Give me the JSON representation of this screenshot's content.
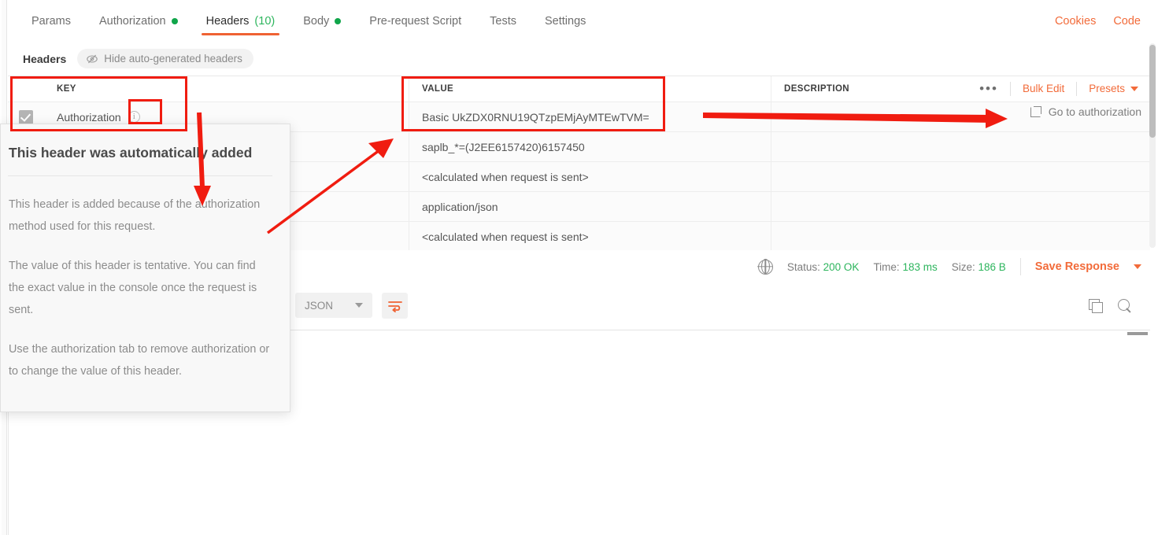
{
  "tabs": [
    {
      "label": "Params",
      "dot": false,
      "count": "",
      "active": false
    },
    {
      "label": "Authorization",
      "dot": true,
      "count": "",
      "active": false
    },
    {
      "label": "Headers",
      "dot": false,
      "count": "(10)",
      "active": true
    },
    {
      "label": "Body",
      "dot": true,
      "count": "",
      "active": false
    },
    {
      "label": "Pre-request Script",
      "dot": false,
      "count": "",
      "active": false
    },
    {
      "label": "Tests",
      "dot": false,
      "count": "",
      "active": false
    },
    {
      "label": "Settings",
      "dot": false,
      "count": "",
      "active": false
    }
  ],
  "tabbar_right": {
    "cookies": "Cookies",
    "code": "Code"
  },
  "subheader": {
    "title": "Headers",
    "hide_auto_label": "Hide auto-generated headers",
    "hide_auto_icon": "eye-slash-icon"
  },
  "table": {
    "columns": {
      "key": "KEY",
      "value": "VALUE",
      "description": "DESCRIPTION"
    },
    "tools": {
      "more_icon": "ellipsis-icon",
      "bulk_edit": "Bulk Edit",
      "presets": "Presets",
      "presets_caret": "chevron-down-icon"
    },
    "rows": [
      {
        "checked": true,
        "key": "Authorization",
        "info": true,
        "value": "Basic UkZDX0RNU19QTzpEMjAyMTEwTVM=",
        "description": ""
      },
      {
        "checked": true,
        "key": "",
        "info": false,
        "value": "saplb_*=(J2EE6157420)6157450",
        "description": ""
      },
      {
        "checked": true,
        "key": "",
        "info": false,
        "value": "<calculated when request is sent>",
        "description": ""
      },
      {
        "checked": true,
        "key": "",
        "info": false,
        "value": "application/json",
        "description": ""
      },
      {
        "checked": true,
        "key": "",
        "info": false,
        "value": "<calculated when request is sent>",
        "description": ""
      }
    ],
    "goto_auth": {
      "label": "Go to authorization",
      "icon": "external-link-icon"
    }
  },
  "popover": {
    "title": "This header was automatically added",
    "paragraphs": [
      "This header is added because of the authorization method used for this request.",
      "The value of this header is tentative. You can find the exact value in the console once the request is sent.",
      "Use the authorization tab to remove authorization or to change the value of this header."
    ]
  },
  "response": {
    "globe_icon": "globe-icon",
    "status_label": "Status:",
    "status_value": "200 OK",
    "time_label": "Time:",
    "time_value": "183 ms",
    "size_label": "Size:",
    "size_value": "186 B",
    "save_response": "Save Response",
    "save_caret": "chevron-down-icon",
    "format_select": "JSON",
    "format_caret": "chevron-down-icon",
    "wrap_icon": "word-wrap-icon",
    "copy_icon": "copy-icon",
    "search_icon": "search-icon"
  },
  "colors": {
    "accent": "#f26b3a",
    "tab_underline": "#ef6233",
    "success": "#2db55d",
    "dot_green": "#10a54a",
    "annotation_red": "#f01c10"
  }
}
